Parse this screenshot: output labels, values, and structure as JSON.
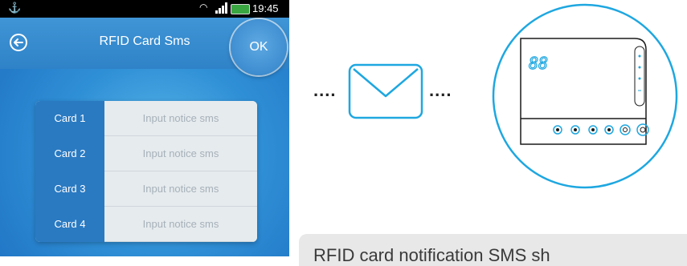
{
  "status_bar": {
    "time": "19:45"
  },
  "header": {
    "title": "RFID Card Sms",
    "ok_label": "OK"
  },
  "cards": [
    {
      "label": "Card 1",
      "placeholder": "Input notice sms"
    },
    {
      "label": "Card 2",
      "placeholder": "Input notice sms"
    },
    {
      "label": "Card 3",
      "placeholder": "Input notice sms"
    },
    {
      "label": "Card 4",
      "placeholder": "Input notice sms"
    }
  ],
  "illustration": {
    "dots_left": "....",
    "dots_right": "....",
    "display_digits": "88"
  },
  "caption": "RFID card notification SMS sh",
  "colors": {
    "accent": "#2a7ac2",
    "device_outline": "#1ea7e0",
    "caption_bg": "#e8e8e8"
  }
}
